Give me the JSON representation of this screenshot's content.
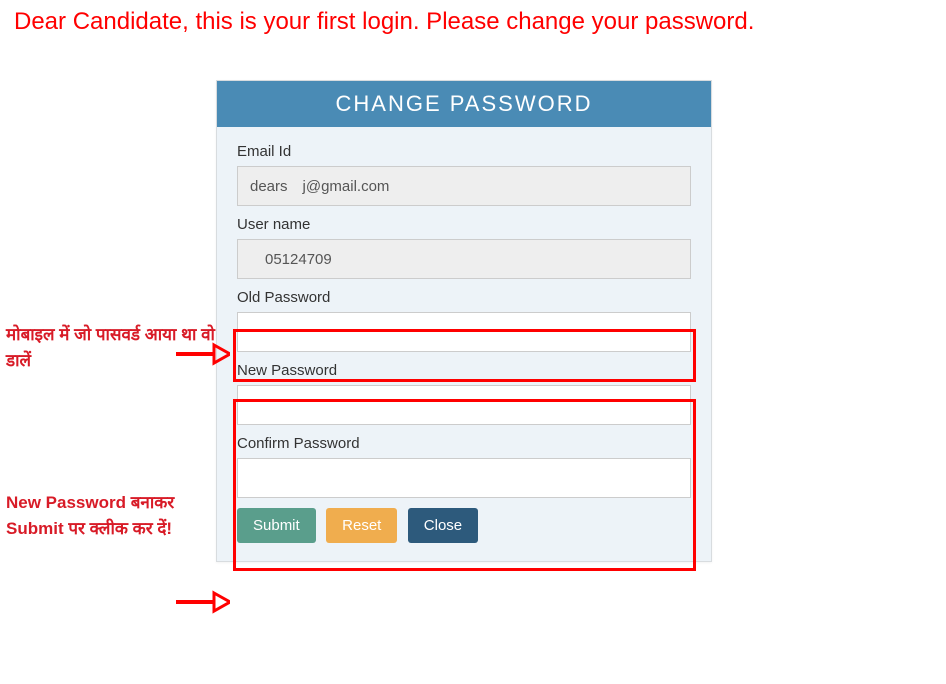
{
  "notice": "Dear Candidate, this is your first login. Please change your password.",
  "panel": {
    "title": "CHANGE PASSWORD",
    "fields": {
      "email_label": "Email Id",
      "email_value": "dears j@gmail.com",
      "username_label": "User name",
      "username_value": " 05124709",
      "oldpw_label": "Old Password",
      "oldpw_value": "",
      "newpw_label": "New Password",
      "newpw_value": "",
      "confirmpw_label": "Confirm Password",
      "confirmpw_value": ""
    },
    "buttons": {
      "submit": "Submit",
      "reset": "Reset",
      "close": "Close"
    }
  },
  "annotations": {
    "a1": "मोबाइल में जो पासवर्ड आया था वो डालें",
    "a2_line1": "New Password बनाकर",
    "a2_line2": "Submit पर क्लीक कर दें!"
  }
}
